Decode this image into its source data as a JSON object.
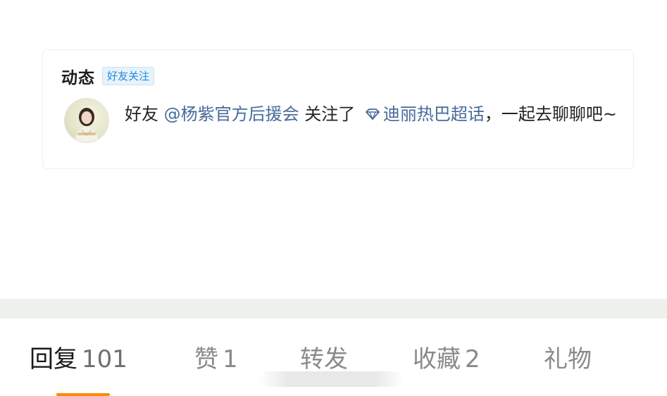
{
  "card": {
    "title": "动态",
    "tag": "好友关注",
    "message": {
      "prefix": "好友",
      "mention": "@杨紫官方后援会",
      "action": " 关注了",
      "topic": "迪丽热巴超话",
      "suffix": "，一起去聊聊吧~"
    },
    "topic_icon": "diamond-icon",
    "avatar_icon": "avatar",
    "colors": {
      "tag_text": "#2b88d8",
      "tag_bg": "#e6f3fc",
      "link": "#476a9a"
    }
  },
  "tabs": [
    {
      "label": "回复",
      "count": "101",
      "active": true
    },
    {
      "label": "赞",
      "count": "1",
      "active": false
    },
    {
      "label": "转发",
      "count": "",
      "active": false
    },
    {
      "label": "收藏",
      "count": "2",
      "active": false
    },
    {
      "label": "礼物",
      "count": "",
      "active": false
    }
  ],
  "accent_color": "#ff8a00"
}
